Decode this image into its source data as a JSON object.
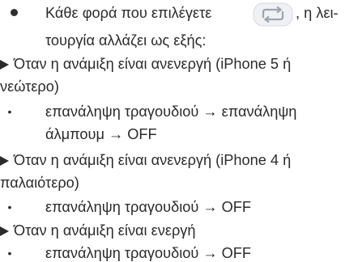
{
  "content": {
    "intro_line_1": "Κάθε φορά που επιλέγετε",
    "intro_line_1_tail": ", η λει-",
    "intro_line_2": "τουργία αλλάζει ως εξής:",
    "case_1_title_line_1": "Όταν η ανάμιξη είναι ανενεργή (iPhone 5 ή",
    "case_1_title_line_2": "νεώτερο)",
    "case_1_item_line_1": "επανάληψη τραγουδιού → επανάληψη",
    "case_1_item_line_2": "άλμπουμ → OFF",
    "case_2_title_line_1": "Όταν η ανάμιξη είναι ανενεργή (iPhone 4 ή",
    "case_2_title_line_2": "παλαιότερο)",
    "case_2_item": "επανάληψη τραγουδιού → OFF",
    "case_3_title": "Όταν η ανάμιξη είναι ενεργή",
    "case_3_item": "επανάληψη τραγουδιού → OFF"
  },
  "icons": {
    "repeat": "repeat-icon",
    "bullet_main": "filled-circle-bullet",
    "pointer": "right-triangle-pointer",
    "small_bullet": "small-bullet"
  },
  "colors": {
    "text": "#2b2b2b",
    "icon_stroke": "#9ea5b0",
    "icon_fill": "#f0f1f4"
  }
}
